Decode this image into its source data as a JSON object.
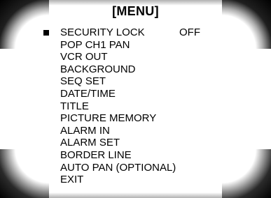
{
  "menu": {
    "title": "[MENU]",
    "items": [
      {
        "label": "SECURITY LOCK",
        "value": "OFF",
        "selected": true
      },
      {
        "label": "POP CH1 PAN"
      },
      {
        "label": "VCR OUT"
      },
      {
        "label": "BACKGROUND"
      },
      {
        "label": "SEQ SET"
      },
      {
        "label": "DATE/TIME"
      },
      {
        "label": "TITLE"
      },
      {
        "label": "PICTURE MEMORY"
      },
      {
        "label": "ALARM IN"
      },
      {
        "label": "ALARM SET"
      },
      {
        "label": "BORDER LINE"
      },
      {
        "label": "AUTO PAN (OPTIONAL)"
      },
      {
        "label": "EXIT"
      }
    ]
  },
  "colors": {
    "text": "#000000",
    "background": "#ffffff"
  },
  "icons": {
    "cursor": "filled-square-cursor-icon"
  }
}
